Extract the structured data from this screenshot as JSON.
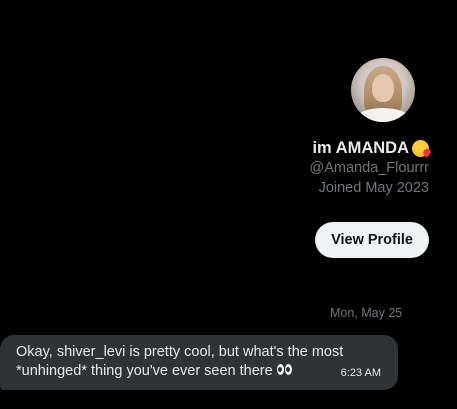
{
  "profile": {
    "display_name": "im AMANDA",
    "name_emoji": "face-blowing-kiss-emoji",
    "handle": "@Amanda_Flourrr",
    "joined": "Joined May 2023",
    "view_profile_label": "View Profile"
  },
  "conversation": {
    "date_separator": "Mon, May 25",
    "messages": [
      {
        "text": "Okay, shiver_levi is pretty cool, but what's the most *unhinged* thing you've ever seen there",
        "emoji": "eyes-emoji",
        "time": "6:23 AM"
      }
    ]
  },
  "colors": {
    "background": "#000000",
    "primary_text": "#e7e9ea",
    "secondary_text": "#71767b",
    "bubble_received": "#2f3336",
    "button_bg": "#eff3f4",
    "button_text": "#0f1419"
  }
}
